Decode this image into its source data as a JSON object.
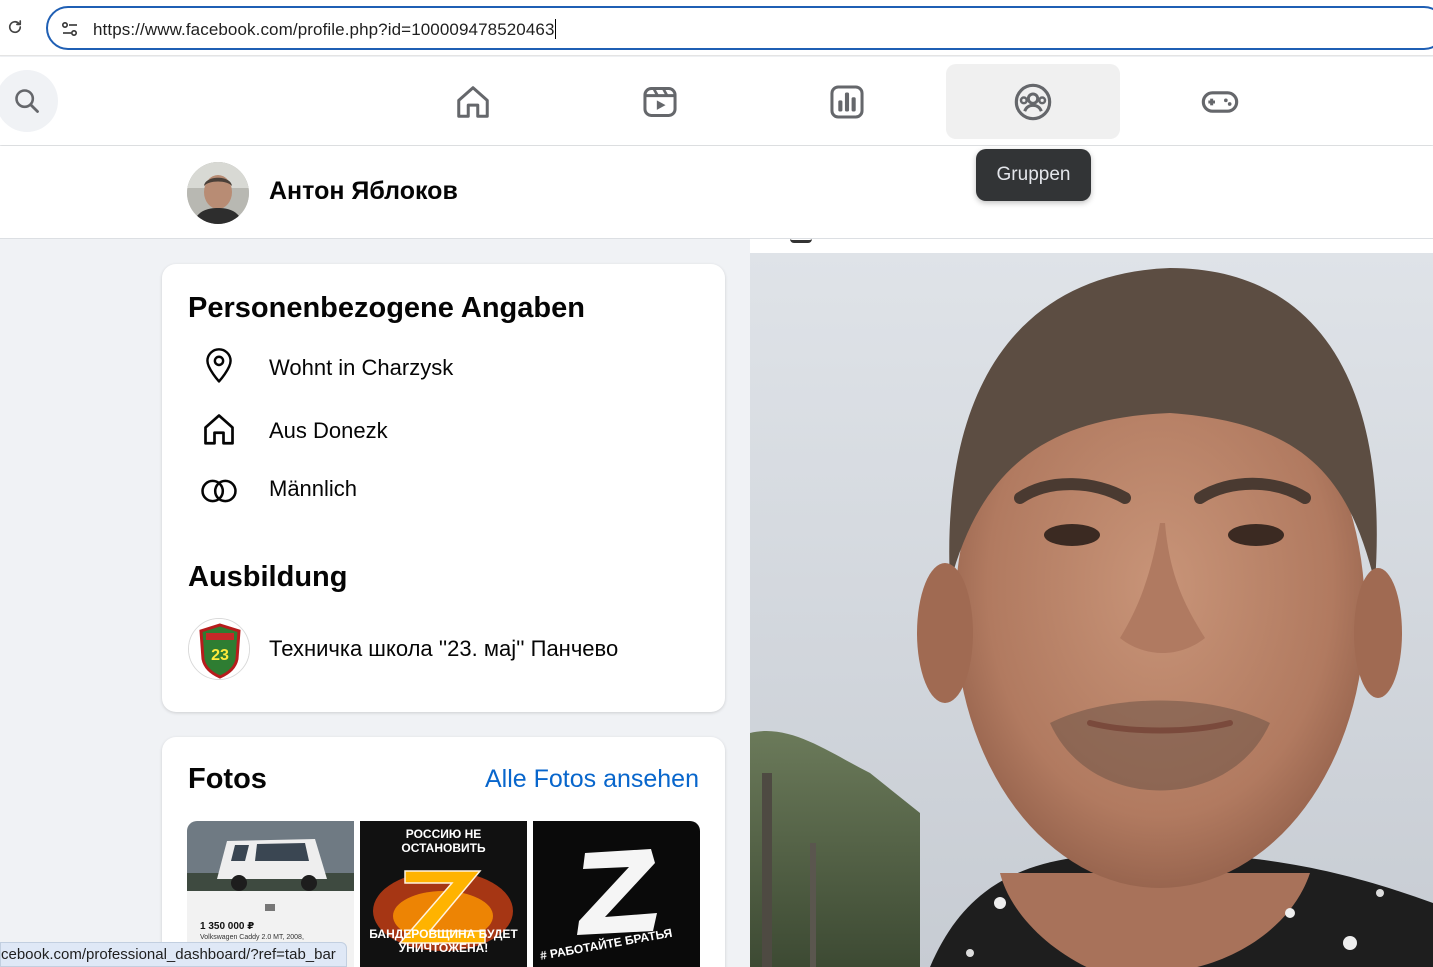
{
  "browser": {
    "url": "https://www.facebook.com/profile.php?id=100009478520463",
    "status_url": "cebook.com/professional_dashboard/?ref=tab_bar"
  },
  "nav": {
    "tabs": [
      {
        "icon": "home-icon"
      },
      {
        "icon": "video-icon"
      },
      {
        "icon": "chart-icon"
      },
      {
        "icon": "groups-icon",
        "active": true
      },
      {
        "icon": "gaming-icon"
      }
    ],
    "tooltip": "Gruppen"
  },
  "profile": {
    "name": "Антон Яблоков"
  },
  "personal": {
    "title": "Personenbezogene Angaben",
    "items": [
      {
        "icon": "location-pin-icon",
        "text": "Wohnt in Charzysk"
      },
      {
        "icon": "home-icon",
        "text": "Aus Donezk"
      },
      {
        "icon": "gender-icon",
        "text": "Männlich"
      }
    ]
  },
  "education": {
    "title": "Ausbildung",
    "school": "Техничка школа ''23. мај'' Панчево",
    "logo_text": "23"
  },
  "photos": {
    "title": "Fotos",
    "link": "Alle Fotos ansehen",
    "thumb1": {
      "price": "1 350 000 ₽",
      "caption": "Volkswagen Caddy 2.0 MT, 2008,"
    },
    "thumb2": {
      "top": "РОССИЮ НЕ ОСТАНОВИТЬ",
      "bottom": "БАНДЕРОВЩИНА БУДЕТ УНИЧТОЖЕНА!"
    },
    "thumb3": {
      "caption": "# РАБОТАЙТЕ БРАТЬЯ"
    }
  },
  "colors": {
    "accent": "#0866cc",
    "url_border": "#1f5fb4",
    "tooltip_bg": "#323436"
  }
}
